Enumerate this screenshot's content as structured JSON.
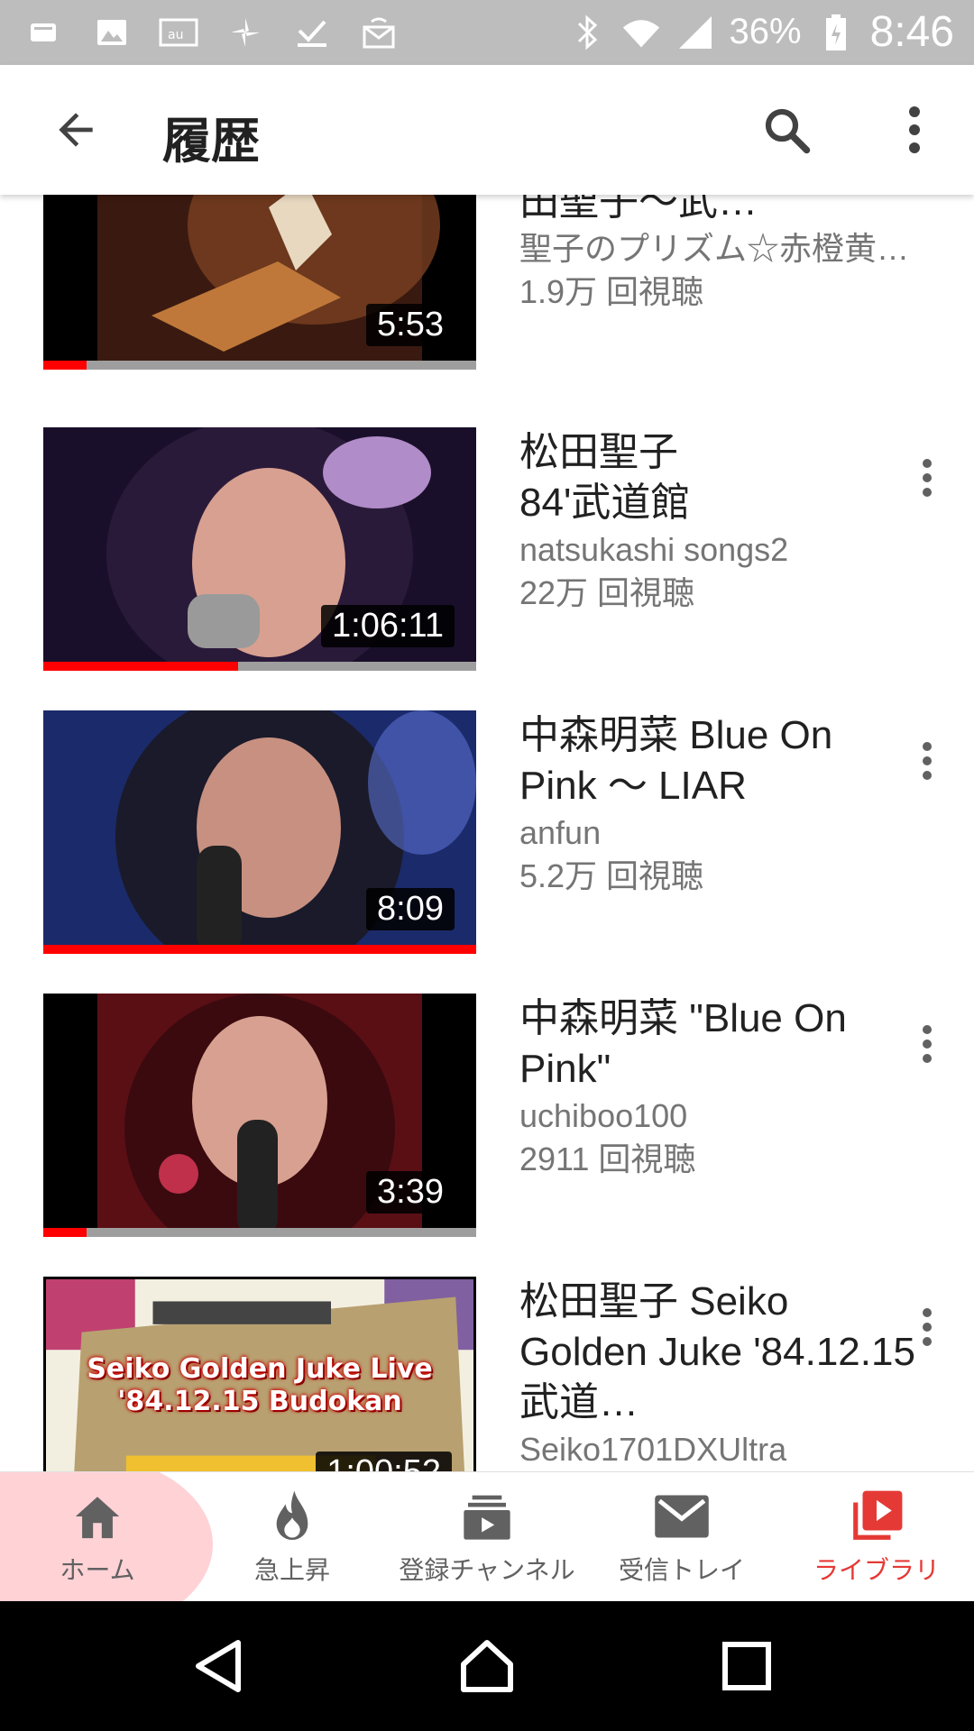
{
  "status_bar": {
    "battery": "36%",
    "time": "8:46"
  },
  "header": {
    "title": "履歴"
  },
  "videos": [
    {
      "title": "弾き語り、MC）／松田聖子〜武…",
      "channel": "聖子のプリズム☆赤橙黄…",
      "views": "1.9万 回視聴",
      "duration": "5:53",
      "progress": 0.1,
      "thumb_colors": [
        "#3a1a10",
        "#c0783a"
      ]
    },
    {
      "title": "松田聖子 84'武道館",
      "channel": "natsukashi songs2",
      "views": "22万 回視聴",
      "duration": "1:06:11",
      "progress": 0.45,
      "thumb_colors": [
        "#2a1a4a",
        "#b08cc8"
      ]
    },
    {
      "title": "中森明菜 Blue On Pink 〜 LIAR",
      "channel": "anfun",
      "views": "5.2万 回視聴",
      "duration": "8:09",
      "progress": 1.0,
      "thumb_colors": [
        "#1b2a6a",
        "#5a6fd0"
      ]
    },
    {
      "title": "中森明菜 \"Blue On Pink\"",
      "channel": "uchiboo100",
      "views": "2911 回視聴",
      "duration": "3:39",
      "progress": 0.1,
      "thumb_colors": [
        "#5a0f15",
        "#c0304a"
      ]
    },
    {
      "title": "松田聖子 Seiko Golden Juke '84.12.15 武道…",
      "channel": "Seiko1701DXUltra",
      "views": "",
      "duration": "1:00:52",
      "progress": 0,
      "thumb_colors": [
        "#f3efe0",
        "#b8a070"
      ],
      "thumb_text_1": "Seiko Golden Juke Live",
      "thumb_text_2": "'84.12.15 Budokan"
    }
  ],
  "bottom_nav": [
    {
      "label": "ホーム",
      "icon": "home-icon",
      "active": false
    },
    {
      "label": "急上昇",
      "icon": "trending-icon",
      "active": false
    },
    {
      "label": "登録チャンネル",
      "icon": "subscriptions-icon",
      "active": false
    },
    {
      "label": "受信トレイ",
      "icon": "inbox-icon",
      "active": false
    },
    {
      "label": "ライブラリ",
      "icon": "library-icon",
      "active": true
    }
  ],
  "colors": {
    "accent": "#ff0000",
    "active_label": "#e53935",
    "status_bar": "#bdbdbd"
  }
}
